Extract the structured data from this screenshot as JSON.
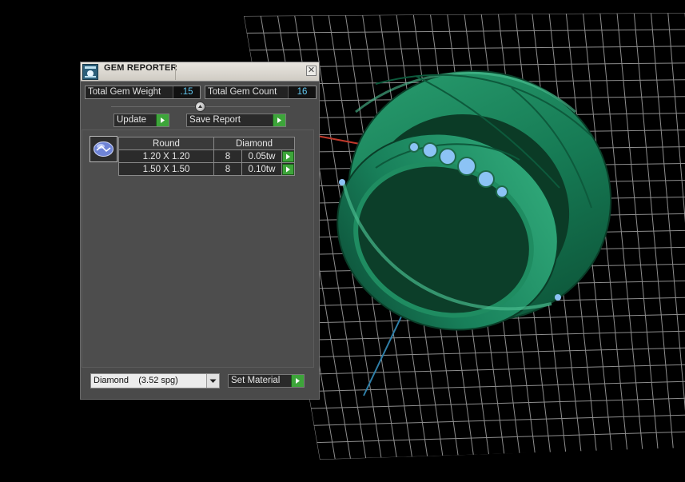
{
  "panel": {
    "title": "GEM REPORTER",
    "close_glyph": "✕",
    "stats": {
      "weight_label": "Total Gem Weight",
      "weight_value": ".15",
      "count_label": "Total Gem Count",
      "count_value": "16"
    },
    "buttons": {
      "update_label": "Update",
      "save_report_label": "Save Report",
      "set_material_label": "Set Material"
    },
    "table": {
      "headers": [
        "Round",
        "Diamond"
      ],
      "rows": [
        {
          "size": "1.20 X 1.20",
          "qty": "8",
          "weight": "0.05tw"
        },
        {
          "size": "1.50 X 1.50",
          "qty": "8",
          "weight": "0.10tw"
        }
      ]
    },
    "material": {
      "selected": "Diamond    (3.52 spg)"
    },
    "icons": [
      "gem-reporter-app-icon",
      "close-icon",
      "slider-knob-icon",
      "play-arrow-icon",
      "round-gem-icon",
      "dropdown-arrow-icon"
    ]
  },
  "scene": {
    "description_colors": {
      "background": "#000000",
      "grid": "#9a9a9a",
      "ring_metal": "#1a7a55",
      "gem_blue": "#7fb6ef",
      "axis_red": "#c0392b",
      "axis_blue": "#2f7fa8"
    }
  }
}
